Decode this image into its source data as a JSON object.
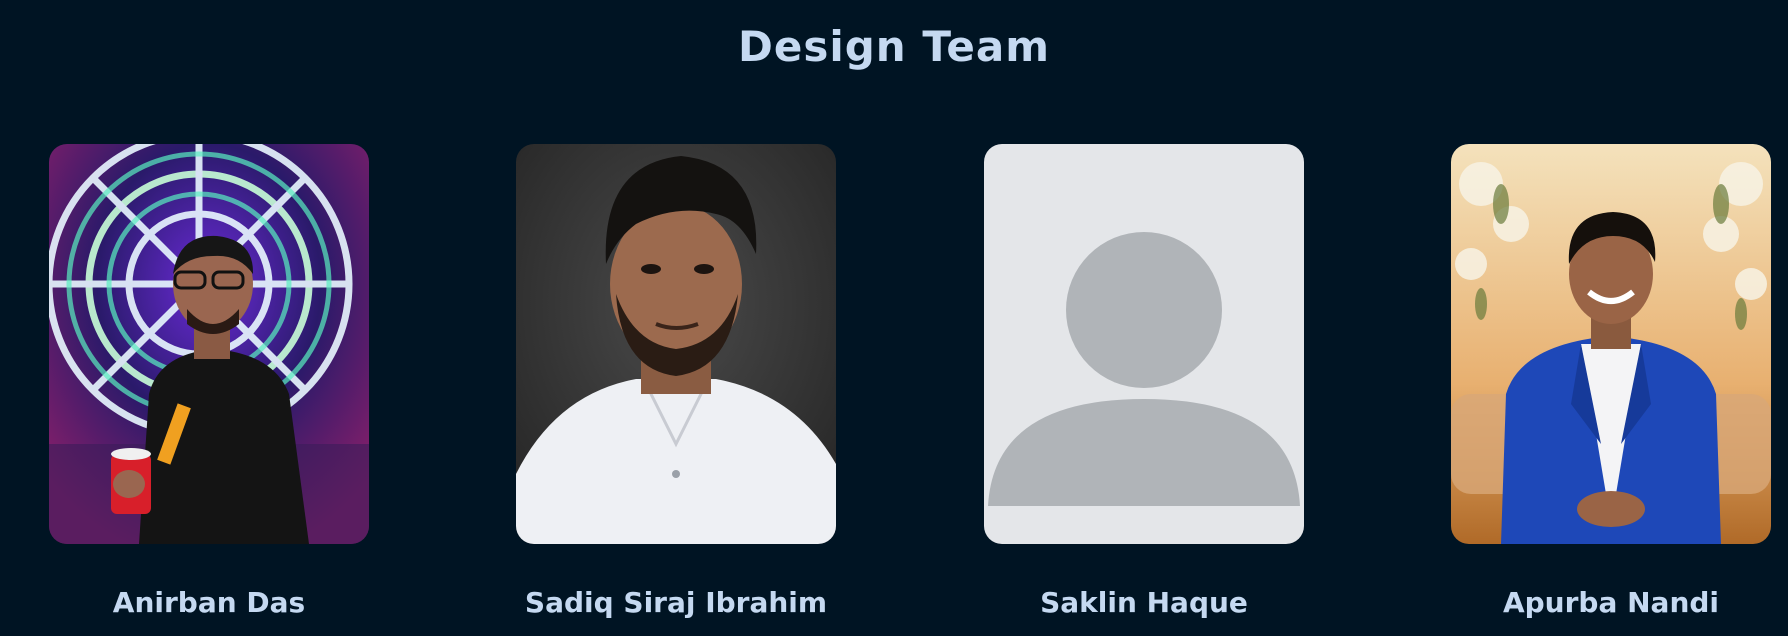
{
  "section": {
    "title": "Design Team"
  },
  "members": [
    {
      "name": "Anirban Das",
      "photo": "neon-wheel-portrait"
    },
    {
      "name": "Sadiq Siraj Ibrahim",
      "photo": "grey-background-portrait"
    },
    {
      "name": "Saklin Haque",
      "photo": "default-avatar-placeholder"
    },
    {
      "name": "Apurba Nandi",
      "photo": "blue-suit-portrait"
    }
  ],
  "colors": {
    "background": "#001423",
    "text": "#c5d9f1",
    "placeholder_bg": "#e4e6e9",
    "placeholder_silhouette": "#b0b4b8"
  }
}
